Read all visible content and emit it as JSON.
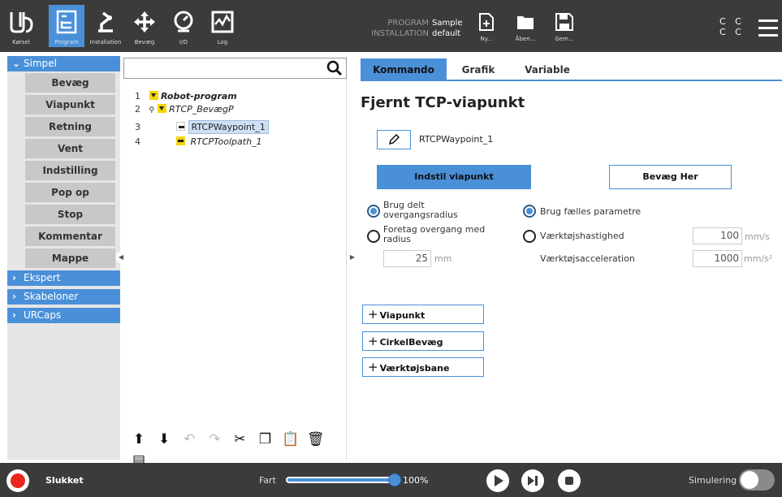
{
  "topbar": {
    "buttons": [
      {
        "name": "ur-logo",
        "label": "Kørsel"
      },
      {
        "name": "program",
        "label": "Program"
      },
      {
        "name": "installation",
        "label": "Installation"
      },
      {
        "name": "move",
        "label": "Bevæg"
      },
      {
        "name": "io",
        "label": "I/O"
      },
      {
        "name": "log",
        "label": "Log"
      }
    ],
    "active": "Program",
    "program_key": "PROGRAM",
    "program_value": "Sample",
    "installation_key": "INSTALLATION",
    "installation_value": "default",
    "file_buttons": [
      {
        "label": "Ny..."
      },
      {
        "label": "Åben..."
      },
      {
        "label": "Gem..."
      }
    ],
    "cc_row1": "C C",
    "cc_row2": "C C",
    "accent": "#4a90d9",
    "bg": "#3b3b3b"
  },
  "leftnav": {
    "categories": [
      {
        "label": "Simpel",
        "expanded": true
      },
      {
        "label": "Ekspert",
        "expanded": false
      },
      {
        "label": "Skabeloner",
        "expanded": false
      },
      {
        "label": "URCaps",
        "expanded": false
      }
    ],
    "items": [
      "Bevæg",
      "Viapunkt",
      "Retning",
      "Vent",
      "Indstilling",
      "Pop op",
      "Stop",
      "Kommentar",
      "Mappe"
    ]
  },
  "tree": {
    "search_icon": "search-icon",
    "rows": [
      {
        "num": "1",
        "label": "Robot-program"
      },
      {
        "num": "2",
        "label": "RTCP_BevægP"
      },
      {
        "num": "3",
        "label": "RTCPWaypoint_1"
      },
      {
        "num": "4",
        "label": "RTCPToolpath_1"
      }
    ],
    "toolbar_icons": [
      "arrow-up-icon",
      "arrow-down-icon",
      "undo-icon",
      "redo-icon",
      "cut-icon",
      "copy-icon",
      "paste-icon",
      "delete-icon",
      "suppress-icon"
    ]
  },
  "tabs": [
    "Kommando",
    "Grafik",
    "Variable"
  ],
  "active_tab": "Kommando",
  "node": {
    "title": "Fjernt TCP-viapunkt",
    "waypoint_name": "RTCPWaypoint_1",
    "set_waypoint": "Indstil viapunkt",
    "move_here": "Bevæg Her",
    "blend_shared": "Brug delt\novergangsradius",
    "blend_radius": "Foretag overgang med\nradius",
    "radius_value": "25",
    "radius_unit": "mm",
    "shared_params": "Brug fælles parametre",
    "tool_speed": "Værktøjshastighed",
    "tool_speed_value": "100",
    "tool_speed_unit": "mm/s",
    "tool_accel": "Værktøjsacceleration",
    "tool_accel_value": "1000",
    "tool_accel_unit": "mm/s²",
    "add_buttons": [
      "Viapunkt",
      "CirkelBevæg",
      "Værktøjsbane"
    ]
  },
  "bottombar": {
    "status": "Slukket",
    "speed_label": "Fart",
    "speed_value": "100%",
    "speed_fraction": 1.0,
    "simulation_label": "Simulering",
    "simulation_on": false,
    "status_color": "#e8261c"
  }
}
